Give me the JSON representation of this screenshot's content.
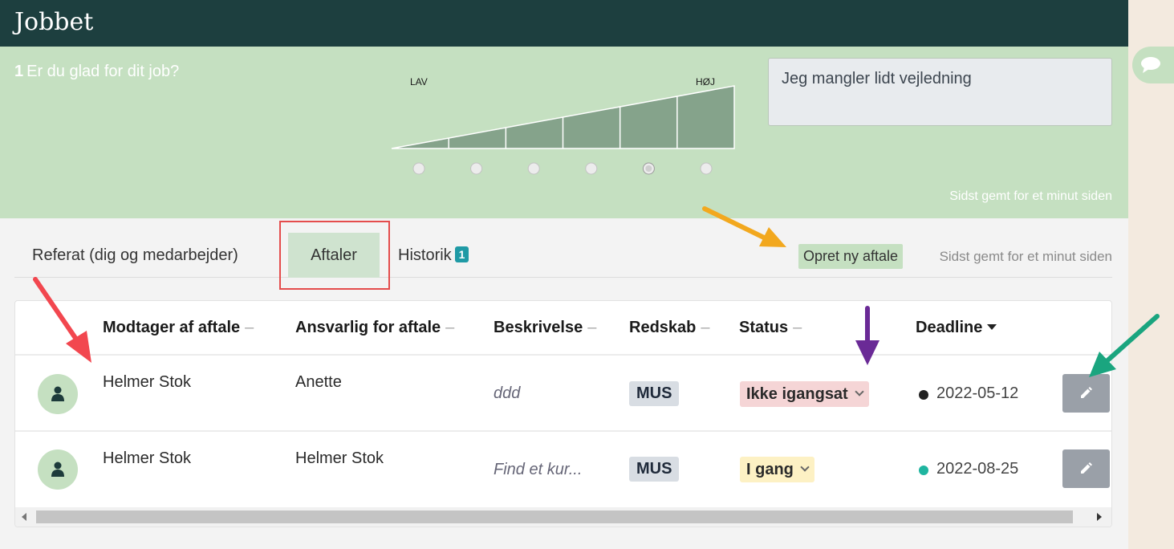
{
  "header": {
    "title": "Jobbet"
  },
  "question": {
    "number": "1",
    "text": "Er du glad for dit job?",
    "scale_low": "LAV",
    "scale_high": "HØJ",
    "scale_steps": 6,
    "selected_step": 5,
    "answer": "Jeg mangler lidt vejledning",
    "saved": "Sidst gemt for et minut siden"
  },
  "chat_icon": "chat-bubble-icon",
  "tabs": [
    {
      "label": "Referat (dig og medarbejder)"
    },
    {
      "label": "Aftaler",
      "active": true
    },
    {
      "label": "Historik",
      "badge": "1"
    }
  ],
  "toolbar": {
    "new_label": "Opret ny aftale",
    "saved": "Sidst gemt for et minut siden"
  },
  "table": {
    "headers": [
      "Modtager af aftale",
      "Ansvarlig for aftale",
      "Beskrivelse",
      "Redskab",
      "Status",
      "Deadline"
    ],
    "sort_column": "Deadline",
    "rows": [
      {
        "recipient": "Helmer Stok",
        "responsible": "Anette",
        "description": "ddd",
        "tool": "MUS",
        "status": "Ikke igangsat",
        "status_color": "#f5d5d6",
        "deadline": "2022-05-12",
        "deadline_dot": "#222222"
      },
      {
        "recipient": "Helmer Stok",
        "responsible": "Helmer Stok",
        "description": "Find et kur...",
        "tool": "MUS",
        "status": "I gang",
        "status_color": "#fdf1c4",
        "deadline": "2022-08-25",
        "deadline_dot": "#1fb5a0"
      }
    ]
  },
  "colors": {
    "header_bg": "#1d3f3f",
    "question_bg": "#c5e0c1",
    "badge": "#1f9aa5",
    "arrow_red": "#f2474f",
    "arrow_orange": "#f2a81e",
    "arrow_purple": "#6a2a96",
    "arrow_teal": "#1aa57f"
  }
}
